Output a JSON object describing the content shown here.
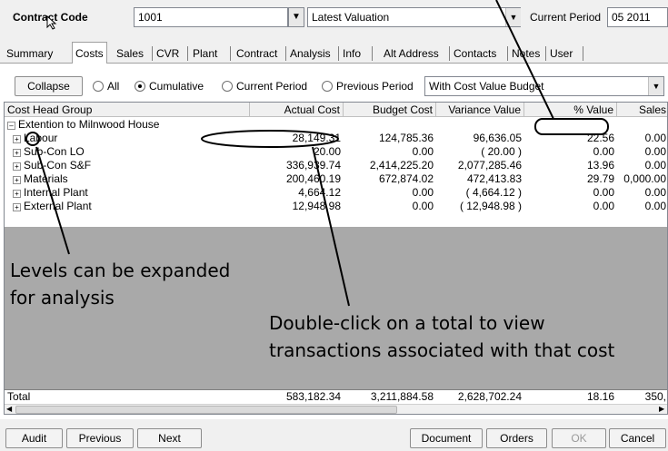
{
  "header": {
    "contract_code_label": "Contract Code",
    "contract_code_value": "1001",
    "valuation_value": "Latest Valuation",
    "current_period_label": "Current Period",
    "current_period_value": "05 2011"
  },
  "tabs": [
    "Summary",
    "Costs",
    "Sales",
    "CVR",
    "Plant",
    "Contract",
    "Analysis",
    "Info",
    "Alt Address",
    "Contacts",
    "Notes",
    "User"
  ],
  "toolbar": {
    "collapse_label": "Collapse",
    "radios": [
      "All",
      "Cumulative",
      "Current Period",
      "Previous Period"
    ],
    "view_select_value": "With Cost Value Budget"
  },
  "grid": {
    "columns": [
      "Cost Head Group",
      "Actual Cost",
      "Budget Cost",
      "Variance Value",
      "% Value",
      "Sales"
    ],
    "group": "Extention to Milnwood House",
    "rows": [
      {
        "name": "Labour",
        "actual": "28,149.31",
        "budget": "124,785.36",
        "variance": "96,636.05",
        "pct": "22.56",
        "sales": "0.00"
      },
      {
        "name": "Sub-Con LO",
        "actual": "20.00",
        "budget": "0.00",
        "variance": "( 20.00 )",
        "pct": "0.00",
        "sales": "0.00"
      },
      {
        "name": "Sub-Con S&F",
        "actual": "336,939.74",
        "budget": "2,414,225.20",
        "variance": "2,077,285.46",
        "pct": "13.96",
        "sales": "0.00"
      },
      {
        "name": "Materials",
        "actual": "200,460.19",
        "budget": "672,874.02",
        "variance": "472,413.83",
        "pct": "29.79",
        "sales": "0,000.00"
      },
      {
        "name": "Internal Plant",
        "actual": "4,664.12",
        "budget": "0.00",
        "variance": "( 4,664.12 )",
        "pct": "0.00",
        "sales": "0.00"
      },
      {
        "name": "External Plant",
        "actual": "12,948.98",
        "budget": "0.00",
        "variance": "( 12,948.98 )",
        "pct": "0.00",
        "sales": "0.00"
      }
    ],
    "total": {
      "name": "Total",
      "actual": "583,182.34",
      "budget": "3,211,884.58",
      "variance": "2,628,702.24",
      "pct": "18.16",
      "sales": "350,"
    }
  },
  "annotations": {
    "expand_note_line1": "Levels can be expanded",
    "expand_note_line2": "for analysis",
    "dblclick_note_line1": "Double-click on a total to view",
    "dblclick_note_line2": "transactions associated with that cost"
  },
  "footer": {
    "audit": "Audit",
    "previous": "Previous",
    "next": "Next",
    "document": "Document",
    "orders": "Orders",
    "ok": "OK",
    "cancel": "Cancel"
  }
}
